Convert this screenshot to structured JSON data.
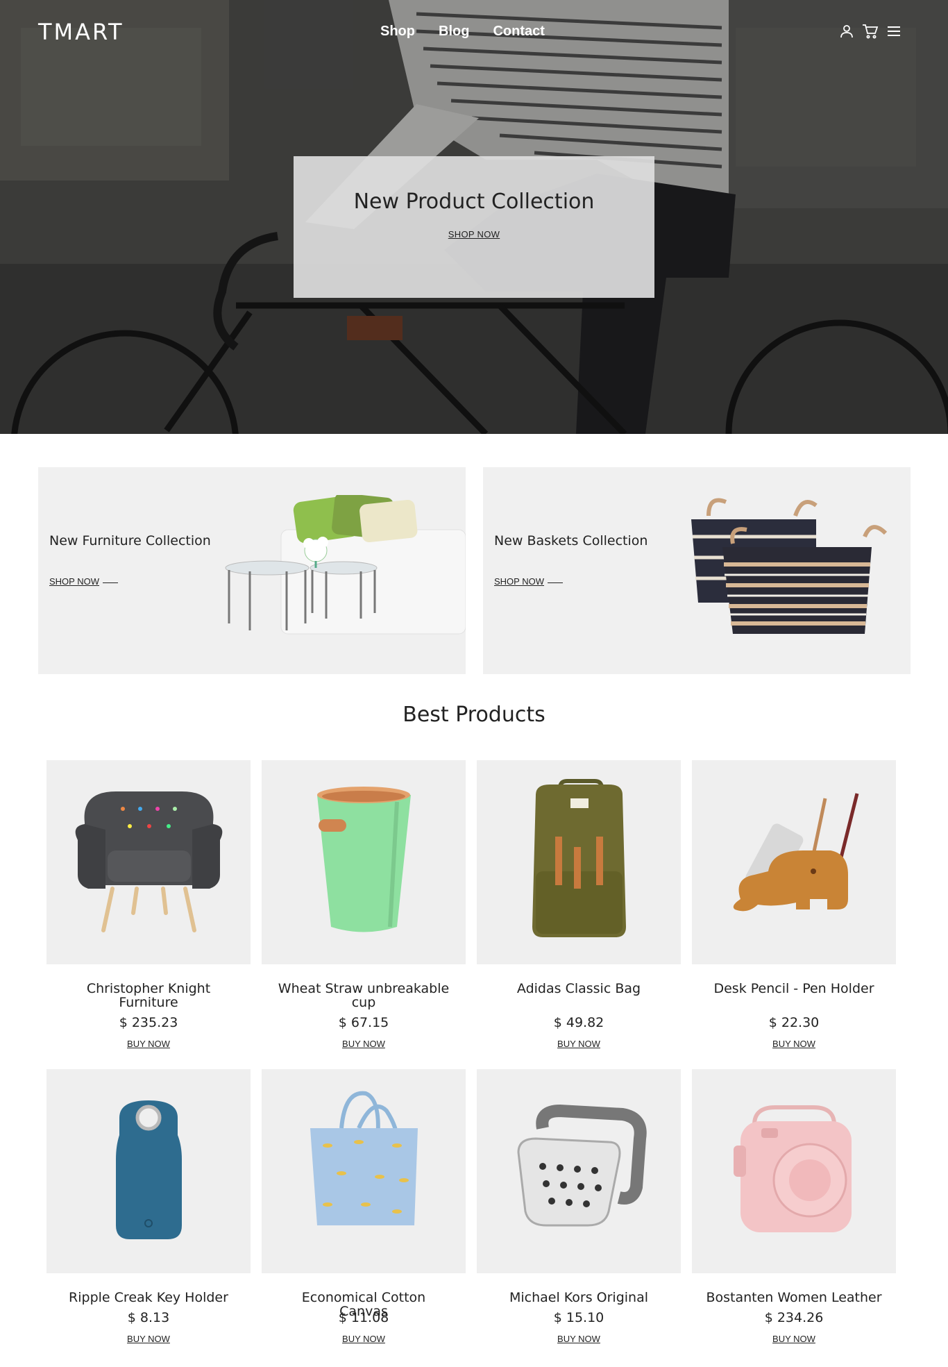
{
  "header": {
    "logo": "TMART",
    "nav": [
      "Shop",
      "Blog",
      "Contact"
    ],
    "icons": [
      "user-icon",
      "cart-icon",
      "menu-icon"
    ]
  },
  "hero": {
    "title": "New Product Collection",
    "cta": "SHOP NOW"
  },
  "banners": [
    {
      "title": "New Furniture Collection",
      "cta": "SHOP NOW"
    },
    {
      "title": "New Baskets Collection",
      "cta": "SHOP NOW"
    }
  ],
  "best_products": {
    "title": "Best Products",
    "items": [
      {
        "name": "Christopher Knight Furniture",
        "price": "$ 235.23",
        "cta": "BUY NOW",
        "icon": "armchair-icon"
      },
      {
        "name": "Wheat Straw unbreakable cup",
        "price": "$ 67.15",
        "cta": "BUY NOW",
        "icon": "bin-icon"
      },
      {
        "name": "Adidas Classic Bag",
        "price": "$ 49.82",
        "cta": "BUY NOW",
        "icon": "backpack-icon"
      },
      {
        "name": "Desk Pencil - Pen Holder",
        "price": "$ 22.30",
        "cta": "BUY NOW",
        "icon": "pen-holder-icon"
      },
      {
        "name": "Ripple Creak Key Holder",
        "price": "$ 8.13",
        "cta": "BUY NOW",
        "icon": "key-holder-icon"
      },
      {
        "name": "Economical Cotton Canvas",
        "price": "$ 11.08",
        "cta": "BUY NOW",
        "icon": "tote-bag-icon"
      },
      {
        "name": "Michael Kors Original",
        "price": "$ 15.10",
        "cta": "BUY NOW",
        "icon": "sink-caddy-icon"
      },
      {
        "name": "Bostanten Women Leather",
        "price": "$ 234.26",
        "cta": "BUY NOW",
        "icon": "camera-case-icon"
      }
    ]
  },
  "colors": {
    "accent_text": "#222222",
    "product_bg": "#efefef",
    "banner_bg": "#f0f0f0"
  }
}
